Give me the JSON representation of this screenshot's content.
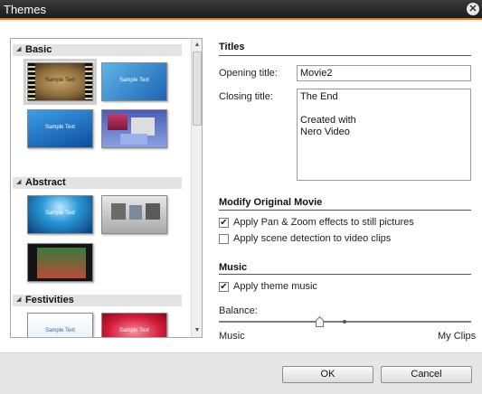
{
  "window": {
    "title": "Themes"
  },
  "themes": {
    "categories": [
      {
        "name": "Basic",
        "items": [
          {
            "caption": "Sample Text",
            "selected": true
          },
          {
            "caption": "Sample Text"
          },
          {
            "caption": "Sample Text"
          },
          {
            "caption": ""
          }
        ]
      },
      {
        "name": "Abstract",
        "items": [
          {
            "caption": "Sample Text"
          },
          {
            "caption": ""
          },
          {
            "caption": ""
          }
        ]
      },
      {
        "name": "Festivities",
        "items": [
          {
            "caption": "Sample Text"
          },
          {
            "caption": "Sample Text"
          }
        ]
      }
    ]
  },
  "titles": {
    "heading": "Titles",
    "opening_label": "Opening title:",
    "opening_value": "Movie2",
    "closing_label": "Closing title:",
    "closing_value": "The End\n\nCreated with\nNero Video"
  },
  "modify": {
    "heading": "Modify Original Movie",
    "pan_zoom_label": "Apply Pan & Zoom effects to still pictures",
    "pan_zoom_checked": true,
    "scene_label": "Apply scene detection to video clips",
    "scene_checked": false
  },
  "music": {
    "heading": "Music",
    "apply_label": "Apply theme music",
    "apply_checked": true,
    "balance_label": "Balance:",
    "left_label": "Music",
    "right_label": "My Clips",
    "balance_fraction": 0.4
  },
  "buttons": {
    "ok": "OK",
    "cancel": "Cancel"
  }
}
